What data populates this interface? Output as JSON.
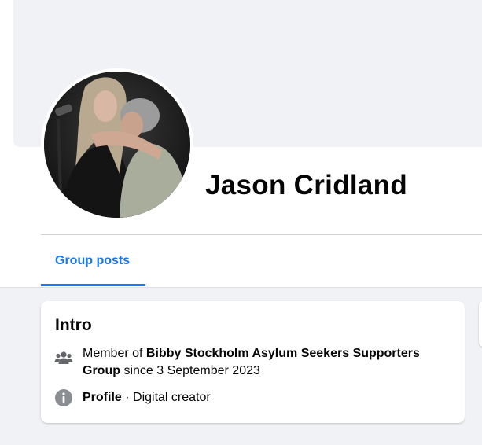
{
  "profile": {
    "name": "Jason Cridland"
  },
  "tabs": [
    {
      "label": "Group posts",
      "active": true
    }
  ],
  "intro": {
    "title": "Intro",
    "member_prefix": "Member of ",
    "group_name": "Bibby Stockholm Asylum Seekers Supporters Group",
    "member_suffix": " since 3 September 2023",
    "profile_label": "Profile",
    "profile_separator": " · ",
    "profile_category": "Digital creator"
  },
  "icons": {
    "members": "group-icon",
    "info": "info-icon"
  },
  "colors": {
    "accent": "#1877f2",
    "page_bg": "#f0f2f5",
    "icon": "#65676b"
  }
}
